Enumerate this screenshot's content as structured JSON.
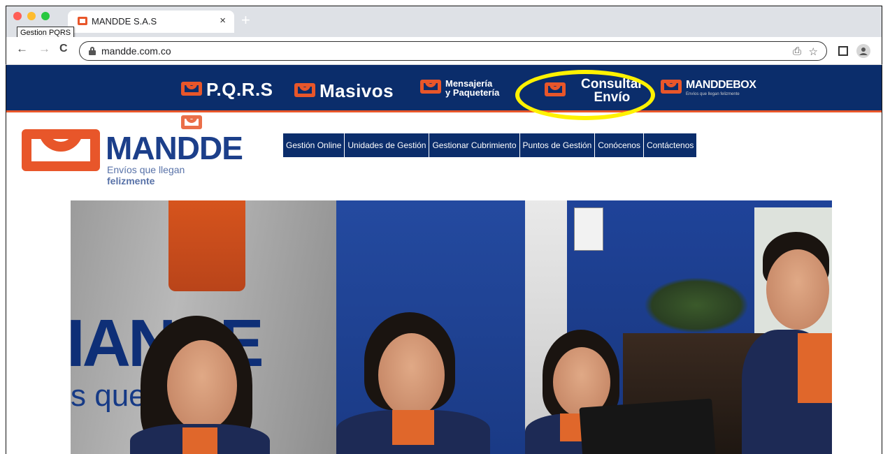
{
  "browser": {
    "tab_title": "MANDDE S.A.S",
    "tooltip": "Gestion PQRS",
    "url": "mandde.com.co",
    "new_tab": "+",
    "close": "×",
    "back": "←",
    "forward": "→",
    "reload": "C",
    "share": "⎙",
    "star": "☆"
  },
  "topnav": {
    "pqrs": "P.Q.R.S",
    "masivos": "Masivos",
    "mensajeria_line1": "Mensajería",
    "mensajeria_line2": "y Paquetería",
    "consultar_line1": "Consultar",
    "consultar_line2": "Envío",
    "manddebox": "MANDDEBOX",
    "manddebox_tag": "Envíos que llegan felizmente"
  },
  "brand": {
    "name": "MANDDE",
    "tagline_prefix": "Envíos que llegan ",
    "tagline_bold": "felizmente"
  },
  "mainmenu": [
    "Gestión Online",
    "Unidades de Gestión",
    "Gestionar Cubrimiento",
    "Puntos de Gestión",
    "Conócenos",
    "Contáctenos"
  ],
  "hero": {
    "sign_text": "IANDE",
    "sign_sub": "s que lleg"
  },
  "colors": {
    "brand_blue": "#0b2d6b",
    "brand_orange": "#e8562a",
    "highlight": "#fff200"
  }
}
